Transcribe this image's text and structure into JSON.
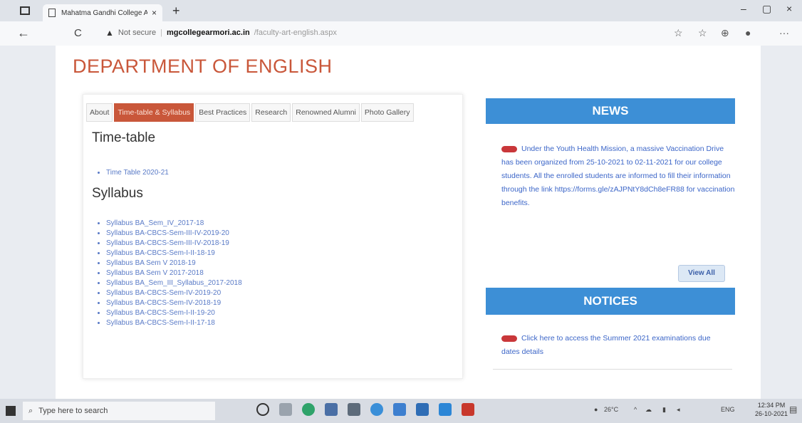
{
  "browser": {
    "tab_title": "Mahatma Gandhi College Arm...",
    "close_glyph": "×",
    "new_tab_glyph": "+",
    "back_glyph": "←",
    "reload_glyph": "C",
    "not_secure": "Not secure",
    "url_host": "mgcollegearmori.ac.in",
    "url_path": "/faculty-art-english.aspx",
    "minimize_glyph": "–",
    "restore_glyph": "▢",
    "close_window_glyph": "×",
    "more_glyph": "···"
  },
  "page": {
    "title": "DEPARTMENT OF ENGLISH",
    "tabs": [
      {
        "label": "About"
      },
      {
        "label": "Time-table & Syllabus"
      },
      {
        "label": "Best Practices"
      },
      {
        "label": "Research"
      },
      {
        "label": "Renowned Alumni"
      },
      {
        "label": "Photo Gallery"
      }
    ],
    "timetable_heading": "Time-table",
    "timetable_links": [
      "Time Table 2020-21"
    ],
    "syllabus_heading": "Syllabus",
    "syllabus_links": [
      "Syllabus BA_Sem_IV_2017-18",
      "Syllabus BA-CBCS-Sem-III-IV-2019-20",
      "Syllabus BA-CBCS-Sem-III-IV-2018-19",
      "Syllabus BA-CBCS-Sem-I-II-18-19",
      "Syllabus BA Sem V 2018-19",
      "Syllabus BA Sem V 2017-2018",
      "Syllabus BA_Sem_III_Syllabus_2017-2018",
      "Syllabus BA-CBCS-Sem-IV-2019-20",
      "Syllabus BA-CBCS-Sem-IV-2018-19",
      "Syllabus BA-CBCS-Sem-I-II-19-20",
      "Syllabus BA-CBCS-Sem-I-II-17-18"
    ],
    "news_heading": "NEWS",
    "news_text": "Under the Youth Health Mission, a massive Vaccination Drive has been organized from 25-10-2021 to 02-11-2021 for our college students. All the enrolled students are informed to fill their information through the link https://forms.gle/zAJPNtY8dCh8eFR88 for vaccination benefits.",
    "view_all": "View All",
    "notices_heading": "NOTICES",
    "notice_text": "Click here to access the Summer 2021 examinations due dates details"
  },
  "taskbar": {
    "search_placeholder": "Type here to search",
    "weather": "26°C",
    "lang": "ENG",
    "time": "12:34 PM",
    "date": "26-10-2021"
  },
  "colors": {
    "accent": "#c9573a",
    "news_blue": "#3d8fd6",
    "link_blue": "#5a7bc7"
  }
}
